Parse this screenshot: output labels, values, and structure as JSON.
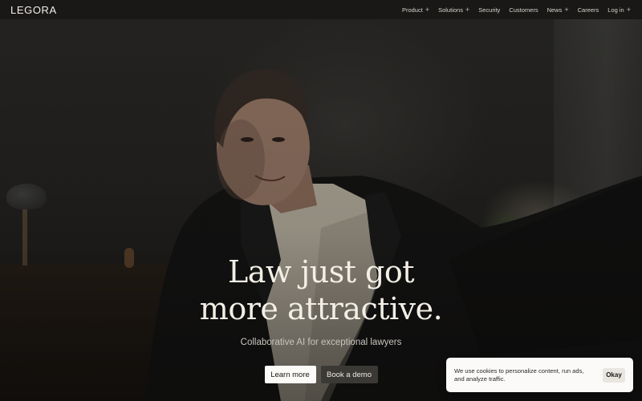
{
  "brand": {
    "logo_text": "LEGORA"
  },
  "nav": {
    "items": [
      {
        "label": "Product",
        "has_plus": true
      },
      {
        "label": "Solutions",
        "has_plus": true
      },
      {
        "label": "Security",
        "has_plus": false
      },
      {
        "label": "Customers",
        "has_plus": false
      },
      {
        "label": "News",
        "has_plus": true
      },
      {
        "label": "Careers",
        "has_plus": false
      },
      {
        "label": "Log in",
        "has_plus": true
      }
    ],
    "plus_glyph": "+"
  },
  "hero": {
    "headline_line1": "Law just got",
    "headline_line2": "more attractive.",
    "subheadline": "Collaborative AI for exceptional lawyers",
    "primary_cta": "Learn more",
    "secondary_cta": "Book a demo"
  },
  "cookie_banner": {
    "text": "We use cookies to personalize content, run ads, and analyze traffic.",
    "button_label": "Okay"
  },
  "colors": {
    "nav_background": "#1a1817",
    "headline": "#f3efe6",
    "primary_button": "#fbfaf7",
    "secondary_button": "#3b3936",
    "cookie_background": "#fbfaf8"
  }
}
